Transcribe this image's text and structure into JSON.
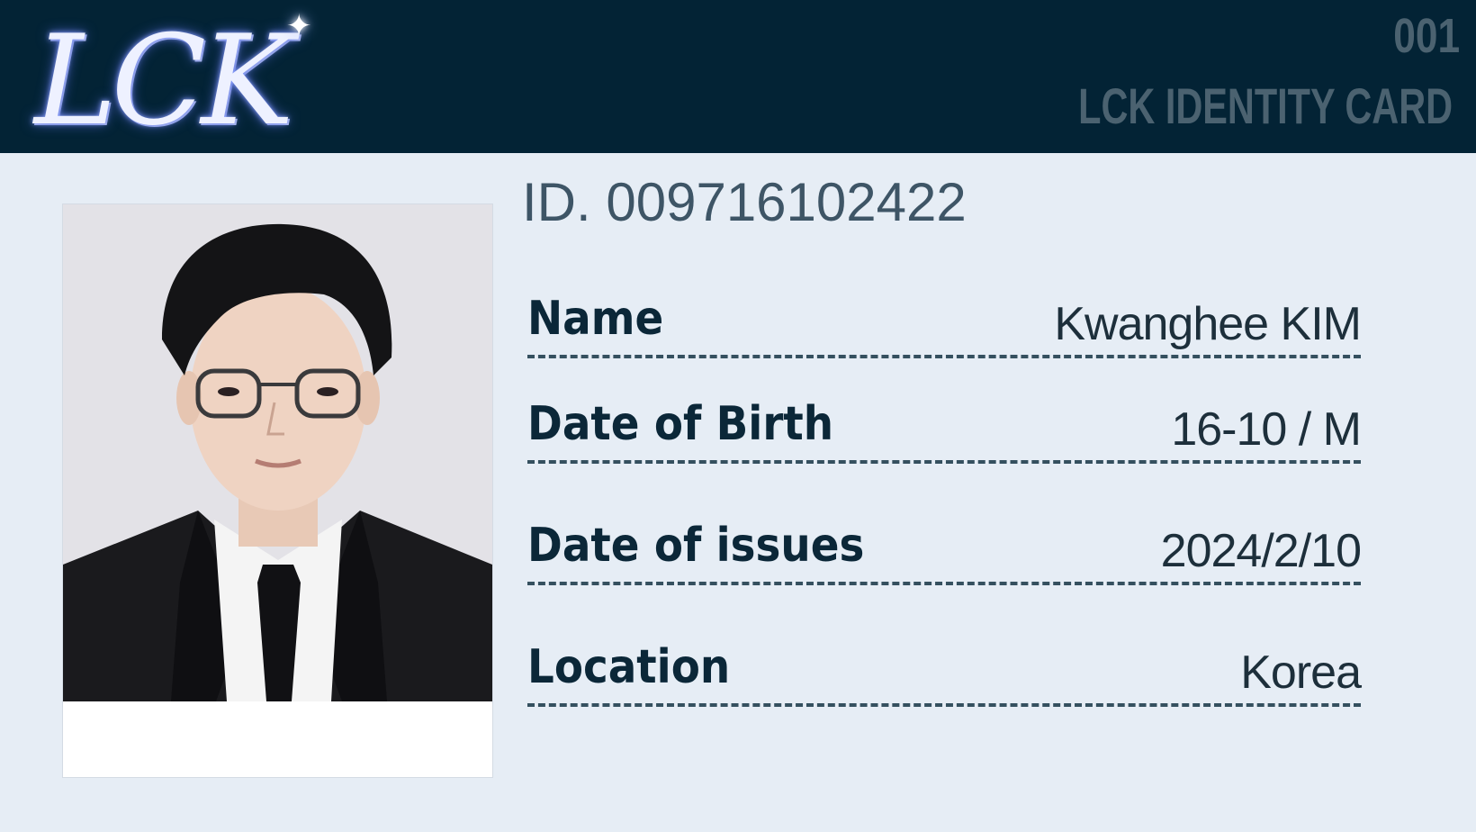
{
  "header": {
    "logo": "LCK",
    "card_number": "001",
    "card_title": "LCK IDENTITY CARD"
  },
  "card": {
    "id_number": "ID. 009716102422",
    "fields": [
      {
        "label": "Name",
        "value": "Kwanghee KIM"
      },
      {
        "label": "Date of Birth",
        "value": "16-10 / M"
      },
      {
        "label": "Date of issues",
        "value": "2024/2/10"
      },
      {
        "label": "Location",
        "value": "Korea"
      }
    ]
  },
  "colors": {
    "header_bg": "#032335",
    "card_bg": "#e6edf5",
    "header_text": "#4b6270",
    "label_text": "#0b2738",
    "dash_line": "#35505f"
  },
  "icons": {
    "logo_sparkle": "sparkle-icon"
  }
}
